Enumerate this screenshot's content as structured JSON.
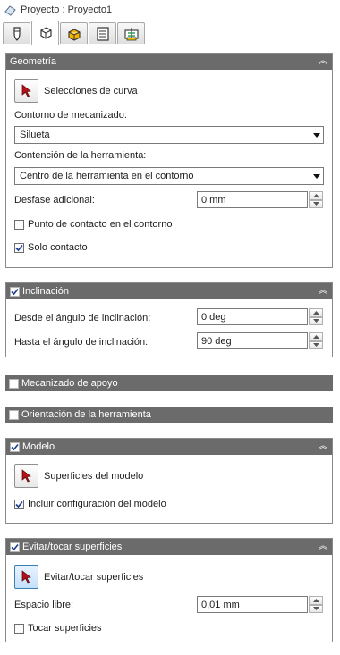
{
  "window": {
    "title": "Proyecto : Proyecto1"
  },
  "tabs": [
    {
      "icon": "tool-icon"
    },
    {
      "icon": "strategy-icon"
    },
    {
      "icon": "part-icon"
    },
    {
      "icon": "list-icon"
    },
    {
      "icon": "link-icon"
    }
  ],
  "sections": {
    "geometry": {
      "title": "Geometría",
      "curve_selection_label": "Selecciones de curva",
      "machining_contour_label": "Contorno de mecanizado:",
      "machining_contour_value": "Silueta",
      "tool_containment_label": "Contención de la herramienta:",
      "tool_containment_value": "Centro de la herramienta en el contorno",
      "additional_offset_label": "Desfase adicional:",
      "additional_offset_value": "0 mm",
      "contact_point_label": "Punto de contacto en el contorno",
      "contact_point_checked": false,
      "contact_only_label": "Solo contacto",
      "contact_only_checked": true
    },
    "tilt": {
      "title": "Inclinación",
      "checked": true,
      "from_angle_label": "Desde el ángulo de inclinación:",
      "from_angle_value": "0 deg",
      "to_angle_label": "Hasta el ángulo de inclinación:",
      "to_angle_value": "90 deg"
    },
    "support": {
      "title": "Mecanizado de apoyo",
      "checked": false
    },
    "orientation": {
      "title": "Orientación de la herramienta",
      "checked": false
    },
    "model": {
      "title": "Modelo",
      "checked": true,
      "surfaces_label": "Superficies del modelo",
      "include_config_label": "Incluir configuración del modelo",
      "include_config_checked": true
    },
    "avoid": {
      "title": "Evitar/tocar superficies",
      "checked": true,
      "surfaces_label": "Evitar/tocar superficies",
      "clearance_label": "Espacio libre:",
      "clearance_value": "0,01 mm",
      "touch_surfaces_label": "Tocar superficies",
      "touch_surfaces_checked": false
    }
  },
  "colors": {
    "header_bg": "#6b6b6b",
    "pick_arrow": "#b3121c",
    "accent_tab": "#f5c400"
  }
}
